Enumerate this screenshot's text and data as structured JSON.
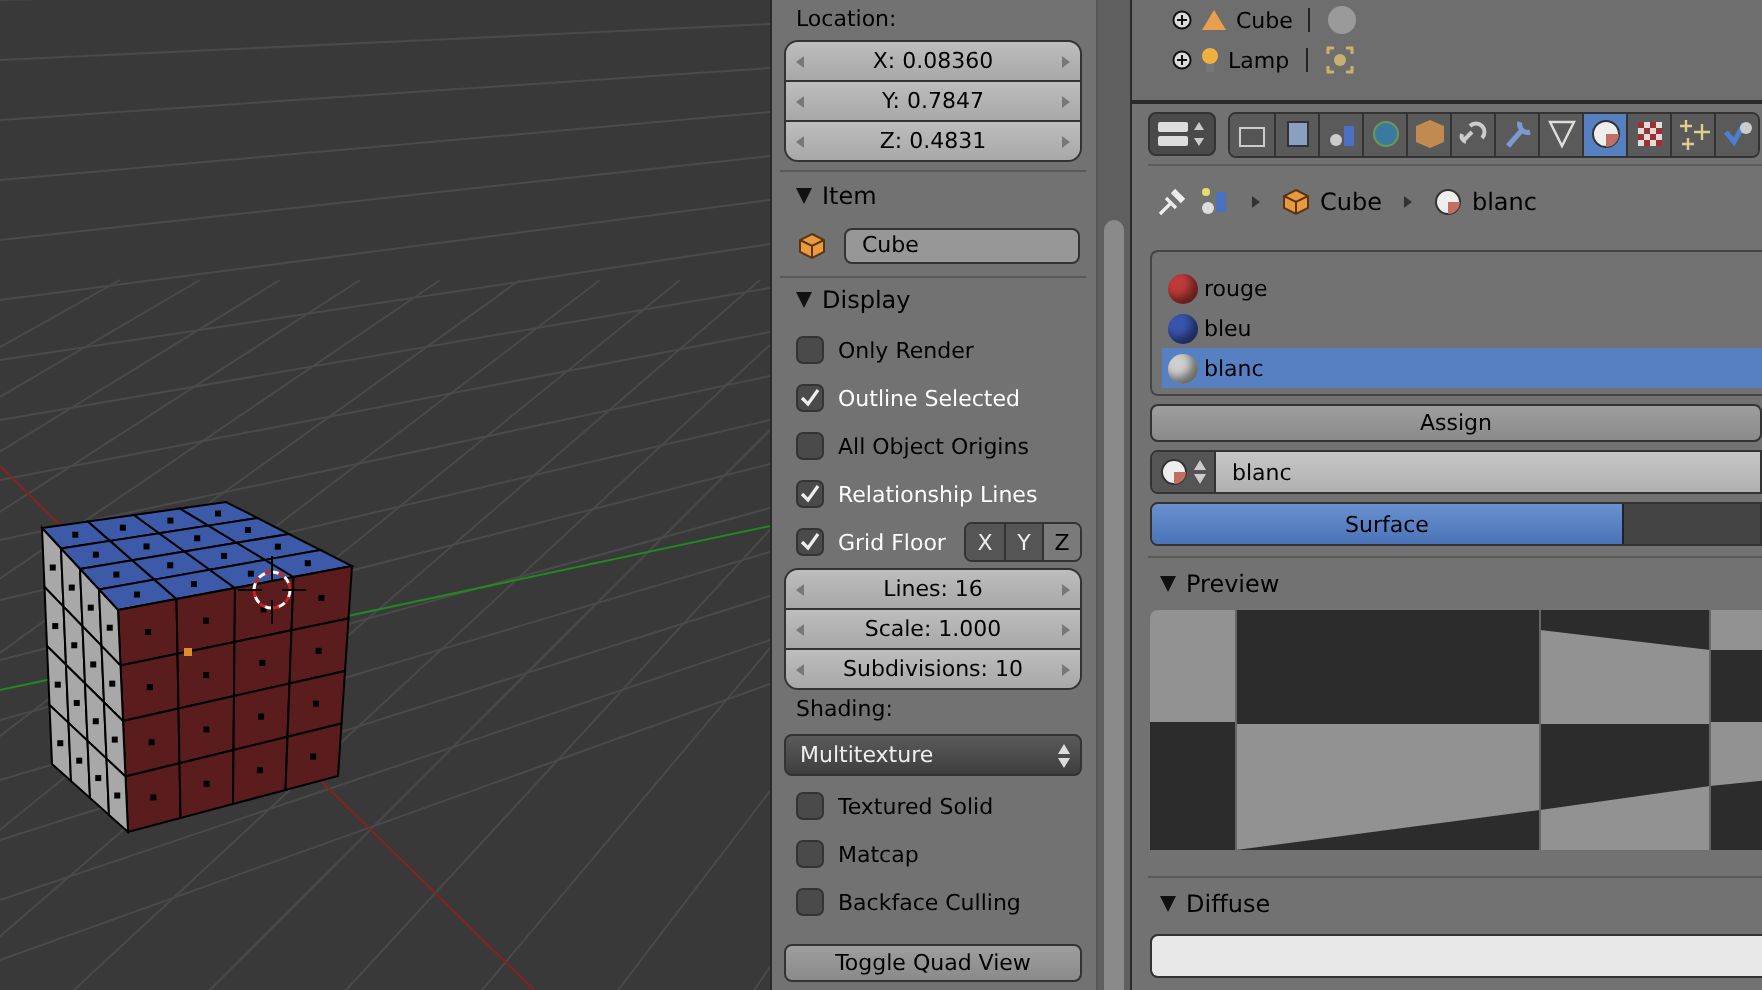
{
  "n_panel": {
    "location": {
      "label": "Location:",
      "fields": [
        "X: 0.08360",
        "Y: 0.7847",
        "Z: 0.4831"
      ]
    },
    "item": {
      "title": "Item",
      "expanded": true,
      "name": "Cube"
    },
    "display": {
      "title": "Display",
      "expanded": true,
      "checks": [
        {
          "label": "Only Render",
          "checked": false
        },
        {
          "label": "Outline Selected",
          "checked": true
        },
        {
          "label": "All Object Origins",
          "checked": false
        },
        {
          "label": "Relationship Lines",
          "checked": true
        }
      ],
      "grid_floor": {
        "label": "Grid Floor",
        "checked": true,
        "axes": [
          {
            "label": "X",
            "selected": false
          },
          {
            "label": "Y",
            "selected": false
          },
          {
            "label": "Z",
            "selected": true
          }
        ]
      },
      "grid_fields": [
        "Lines: 16",
        "Scale: 1.000",
        "Subdivisions: 10"
      ],
      "shading_label": "Shading:",
      "shading_value": "Multitexture",
      "shading_checks": [
        {
          "label": "Textured Solid",
          "checked": false
        },
        {
          "label": "Matcap",
          "checked": false
        },
        {
          "label": "Backface Culling",
          "checked": false
        }
      ],
      "button": "Toggle Quad View"
    }
  },
  "outliner": {
    "items": [
      {
        "label": "Cube",
        "kind": "mesh"
      },
      {
        "label": "Lamp",
        "kind": "lamp"
      }
    ]
  },
  "properties": {
    "tabs": [
      {
        "selected": false
      },
      {
        "selected": false
      },
      {
        "selected": false
      },
      {
        "selected": false
      },
      {
        "selected": false
      },
      {
        "selected": false
      },
      {
        "selected": false
      },
      {
        "selected": false
      },
      {
        "selected": true
      },
      {
        "selected": false
      },
      {
        "selected": false
      },
      {
        "selected": false
      }
    ],
    "breadcrumb": [
      "Cube",
      "blanc"
    ],
    "slots": [
      {
        "label": "rouge",
        "color": "#c03a3a",
        "selected": false
      },
      {
        "label": "bleu",
        "color": "#3a55b0",
        "selected": false
      },
      {
        "label": "blanc",
        "color": "#d0d0d0",
        "selected": true
      }
    ],
    "assign": "Assign",
    "material": "blanc",
    "modes": [
      {
        "label": "Surface",
        "selected": true
      },
      {
        "selected": false
      }
    ],
    "preview": {
      "title": "Preview",
      "expanded": true
    },
    "diffuse": {
      "title": "Diffuse",
      "expanded": true
    }
  }
}
